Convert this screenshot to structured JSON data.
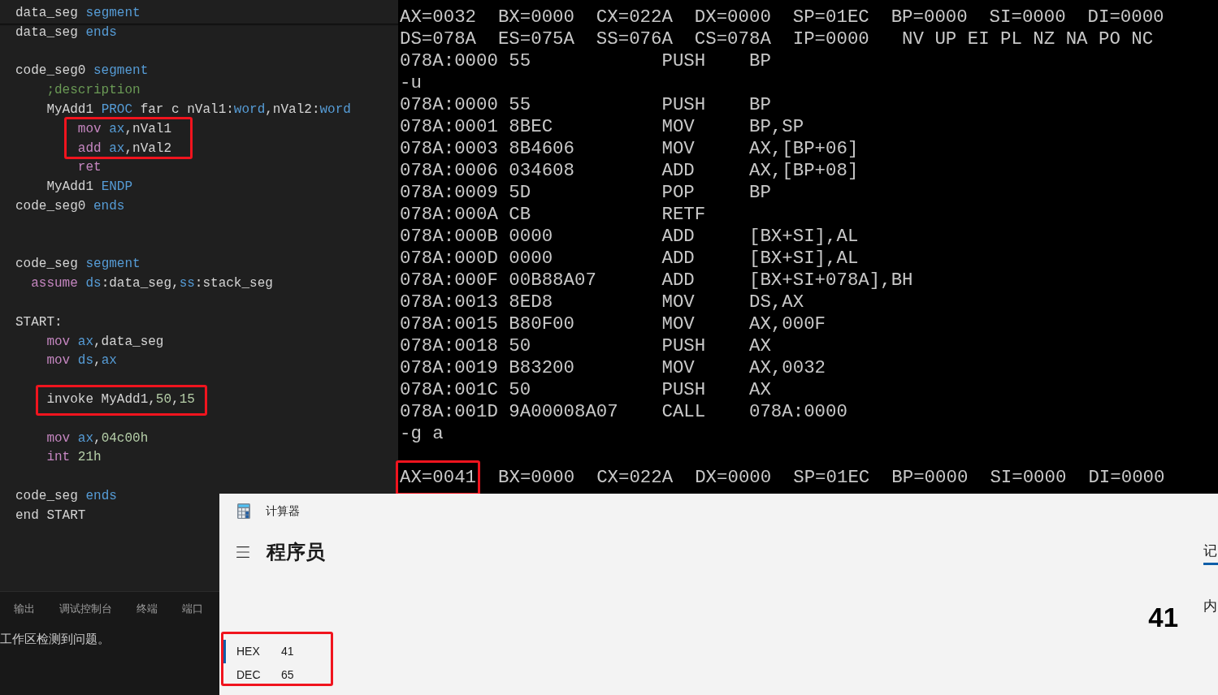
{
  "editor": {
    "lines": [
      {
        "kind": "code",
        "tokens": [
          {
            "t": "data_seg ",
            "kind": "plain"
          },
          {
            "t": "segment",
            "kind": "keyword"
          }
        ]
      },
      {
        "kind": "code",
        "tokens": [
          {
            "t": "data_seg ",
            "kind": "plain"
          },
          {
            "t": "ends",
            "kind": "keyword"
          }
        ]
      },
      {
        "kind": "blank"
      },
      {
        "kind": "code",
        "tokens": [
          {
            "t": "code_seg0 ",
            "kind": "plain"
          },
          {
            "t": "segment",
            "kind": "keyword"
          }
        ]
      },
      {
        "kind": "code",
        "tokens": [
          {
            "t": "    ;description",
            "kind": "comment"
          }
        ]
      },
      {
        "kind": "code",
        "tokens": [
          {
            "t": "    MyAdd1 ",
            "kind": "plain"
          },
          {
            "t": "PROC",
            "kind": "keyword"
          },
          {
            "t": " far c nVal1:",
            "kind": "plain"
          },
          {
            "t": "word",
            "kind": "keyword"
          },
          {
            "t": ",nVal2:",
            "kind": "plain"
          },
          {
            "t": "word",
            "kind": "keyword"
          }
        ]
      },
      {
        "kind": "code",
        "tokens": [
          {
            "t": "        mov ",
            "kind": "instr"
          },
          {
            "t": "ax",
            "kind": "keyword"
          },
          {
            "t": ",nVal1",
            "kind": "plain"
          }
        ]
      },
      {
        "kind": "code",
        "tokens": [
          {
            "t": "        add ",
            "kind": "instr"
          },
          {
            "t": "ax",
            "kind": "keyword"
          },
          {
            "t": ",nVal2",
            "kind": "plain"
          }
        ]
      },
      {
        "kind": "code",
        "tokens": [
          {
            "t": "        ret",
            "kind": "instr"
          }
        ]
      },
      {
        "kind": "code",
        "tokens": [
          {
            "t": "    MyAdd1 ",
            "kind": "plain"
          },
          {
            "t": "ENDP",
            "kind": "keyword"
          }
        ]
      },
      {
        "kind": "code",
        "tokens": [
          {
            "t": "code_seg0 ",
            "kind": "plain"
          },
          {
            "t": "ends",
            "kind": "keyword"
          }
        ]
      },
      {
        "kind": "blank"
      },
      {
        "kind": "blank"
      },
      {
        "kind": "code",
        "tokens": [
          {
            "t": "code_seg ",
            "kind": "plain"
          },
          {
            "t": "segment",
            "kind": "keyword"
          }
        ]
      },
      {
        "kind": "code",
        "tokens": [
          {
            "t": "  assume ",
            "kind": "instr"
          },
          {
            "t": "ds",
            "kind": "keyword"
          },
          {
            "t": ":data_seg,",
            "kind": "plain"
          },
          {
            "t": "ss",
            "kind": "keyword"
          },
          {
            "t": ":stack_seg",
            "kind": "plain"
          }
        ]
      },
      {
        "kind": "blank"
      },
      {
        "kind": "code",
        "tokens": [
          {
            "t": "START:",
            "kind": "plain"
          }
        ]
      },
      {
        "kind": "code",
        "tokens": [
          {
            "t": "    mov ",
            "kind": "instr"
          },
          {
            "t": "ax",
            "kind": "keyword"
          },
          {
            "t": ",data_seg",
            "kind": "plain"
          }
        ]
      },
      {
        "kind": "code",
        "tokens": [
          {
            "t": "    mov ",
            "kind": "instr"
          },
          {
            "t": "ds",
            "kind": "keyword"
          },
          {
            "t": ",",
            "kind": "plain"
          },
          {
            "t": "ax",
            "kind": "keyword"
          }
        ]
      },
      {
        "kind": "blank"
      },
      {
        "kind": "code",
        "highlighted": true,
        "tokens": [
          {
            "t": "    invoke MyAdd1,",
            "kind": "plain"
          },
          {
            "t": "50",
            "kind": "number"
          },
          {
            "t": ",",
            "kind": "plain"
          },
          {
            "t": "15",
            "kind": "number"
          }
        ]
      },
      {
        "kind": "blank"
      },
      {
        "kind": "code",
        "tokens": [
          {
            "t": "    mov ",
            "kind": "instr"
          },
          {
            "t": "ax",
            "kind": "keyword"
          },
          {
            "t": ",",
            "kind": "plain"
          },
          {
            "t": "04c00h",
            "kind": "number"
          }
        ]
      },
      {
        "kind": "code",
        "tokens": [
          {
            "t": "    int ",
            "kind": "instr"
          },
          {
            "t": "21h",
            "kind": "number"
          }
        ]
      },
      {
        "kind": "blank"
      },
      {
        "kind": "code",
        "tokens": [
          {
            "t": "code_seg ",
            "kind": "plain"
          },
          {
            "t": "ends",
            "kind": "keyword"
          }
        ]
      },
      {
        "kind": "code",
        "tokens": [
          {
            "t": "end START",
            "kind": "plain"
          }
        ]
      }
    ],
    "panel": {
      "tabs": [
        "输出",
        "调试控制台",
        "终端",
        "端口"
      ],
      "message": "工作区检测到问题。"
    }
  },
  "dosbox": {
    "lines": [
      "AX=0032  BX=0000  CX=022A  DX=0000  SP=01EC  BP=0000  SI=0000  DI=0000",
      "DS=078A  ES=075A  SS=076A  CS=078A  IP=0000   NV UP EI PL NZ NA PO NC",
      "078A:0000 55            PUSH    BP",
      "-u",
      "078A:0000 55            PUSH    BP",
      "078A:0001 8BEC          MOV     BP,SP",
      "078A:0003 8B4606        MOV     AX,[BP+06]",
      "078A:0006 034608        ADD     AX,[BP+08]",
      "078A:0009 5D            POP     BP",
      "078A:000A CB            RETF",
      "078A:000B 0000          ADD     [BX+SI],AL",
      "078A:000D 0000          ADD     [BX+SI],AL",
      "078A:000F 00B88A07      ADD     [BX+SI+078A],BH",
      "078A:0013 8ED8          MOV     DS,AX",
      "078A:0015 B80F00        MOV     AX,000F",
      "078A:0018 50            PUSH    AX",
      "078A:0019 B83200        MOV     AX,0032",
      "078A:001C 50            PUSH    AX",
      "078A:001D 9A00008A07    CALL    078A:0000",
      "-g a"
    ],
    "result_registers": [
      {
        "text": "AX=0041",
        "highlighted": true
      },
      {
        "text": "BX=0000",
        "highlighted": false
      },
      {
        "text": "CX=022A",
        "highlighted": false
      },
      {
        "text": "DX=0000",
        "highlighted": false
      },
      {
        "text": "SP=01EC",
        "highlighted": false
      },
      {
        "text": "BP=0000",
        "highlighted": false
      },
      {
        "text": "SI=0000",
        "highlighted": false
      },
      {
        "text": "DI=0000",
        "highlighted": false
      }
    ]
  },
  "calculator": {
    "title": "计算器",
    "mode": "程序员",
    "display": "41",
    "side_tabs": [
      {
        "label": "记",
        "selected": true
      },
      {
        "label": "内",
        "selected": false
      }
    ],
    "radix": [
      {
        "name": "HEX",
        "value": "41",
        "selected": true
      },
      {
        "name": "DEC",
        "value": "65",
        "selected": false
      }
    ]
  }
}
